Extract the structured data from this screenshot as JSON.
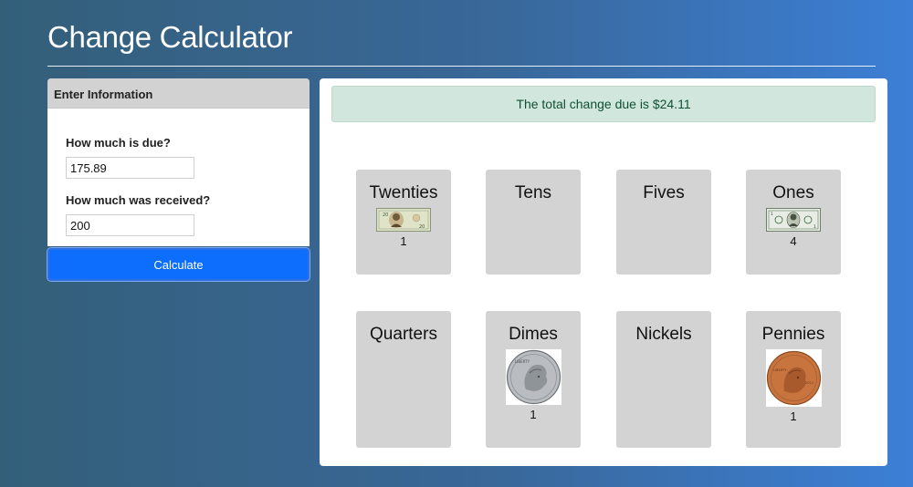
{
  "header": {
    "title": "Change Calculator"
  },
  "info": {
    "title": "Enter Information",
    "due_label": "How much is due?",
    "due_value": "175.89",
    "received_label": "How much was received?",
    "received_value": "200",
    "calculate_label": "Calculate"
  },
  "result": {
    "message": "The total change due is $24.11",
    "colors": {
      "alert_bg": "#d1e7dd",
      "alert_text": "#0f5132",
      "card_bg": "#d3d3d3"
    },
    "denominations": [
      {
        "name": "Twenties",
        "count": "1",
        "image": "twenty-dollar-bill"
      },
      {
        "name": "Tens",
        "count": "",
        "image": ""
      },
      {
        "name": "Fives",
        "count": "",
        "image": ""
      },
      {
        "name": "Ones",
        "count": "4",
        "image": "one-dollar-bill"
      },
      {
        "name": "Quarters",
        "count": "",
        "image": ""
      },
      {
        "name": "Dimes",
        "count": "1",
        "image": "dime-coin"
      },
      {
        "name": "Nickels",
        "count": "",
        "image": ""
      },
      {
        "name": "Pennies",
        "count": "1",
        "image": "penny-coin"
      }
    ]
  }
}
